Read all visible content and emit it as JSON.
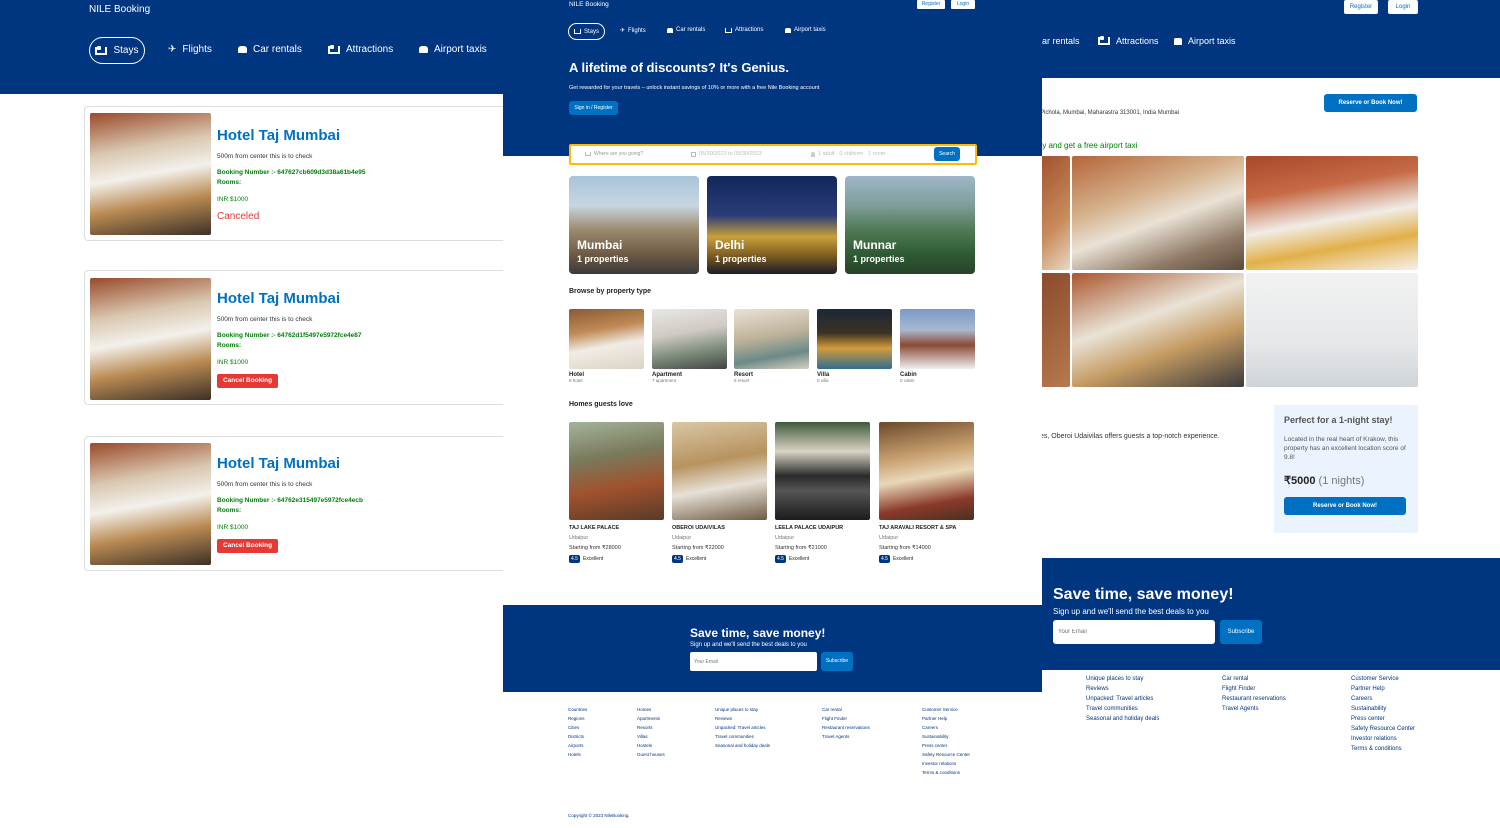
{
  "left": {
    "brand": "NILE Booking",
    "nav": [
      {
        "label": "Stays",
        "icon": "bed-icon"
      },
      {
        "label": "Flights",
        "icon": "plane-icon"
      },
      {
        "label": "Car rentals",
        "icon": "car-icon"
      },
      {
        "label": "Attractions",
        "icon": "bed-icon"
      },
      {
        "label": "Airport taxis",
        "icon": "taxi-icon"
      }
    ],
    "bookings": [
      {
        "title": "Hotel Taj Mumbai",
        "distance": "500m from center this is to check",
        "booking": "Booking Number :- 647627cb609d3d38a61b4e95",
        "rooms": "Rooms:",
        "price": "INR $1000",
        "status": "Canceled",
        "action": ""
      },
      {
        "title": "Hotel Taj Mumbai",
        "distance": "500m from center this is to check",
        "booking": "Booking Number :- 64762d1f5497e5972fce4e87",
        "rooms": "Rooms:",
        "price": "INR $1000",
        "status": "",
        "action": "Cancel Booking"
      },
      {
        "title": "Hotel Taj Mumbai",
        "distance": "500m from center this is to check",
        "booking": "Booking Number :- 64762e315497e5972fce4ecb",
        "rooms": "Rooms:",
        "price": "INR $1000",
        "status": "",
        "action": "Cancel Booking"
      }
    ]
  },
  "middle": {
    "brand": "NILE Booking",
    "register": "Register",
    "login": "Login",
    "nav": [
      "Stays",
      "Flights",
      "Car rentals",
      "Attractions",
      "Airport taxis"
    ],
    "hero_title": "A lifetime of discounts? It's Genius.",
    "hero_text": "Get rewarded for your travels – unlock instant savings of 10% or more with a free Nile Booking account",
    "hero_button": "Sign in / Register",
    "search": {
      "destination_placeholder": "Where are you going?",
      "dates": "05/30/2023 to 05/30/2023",
      "guests": "1 adult · 0 children · 1 room",
      "button": "Search"
    },
    "cities": [
      {
        "name": "Mumbai",
        "count": "1 properties"
      },
      {
        "name": "Delhi",
        "count": "1 properties"
      },
      {
        "name": "Munnar",
        "count": "1 properties"
      }
    ],
    "property_heading": "Browse by property type",
    "property_types": [
      {
        "name": "Hotel",
        "count": "8 hotel"
      },
      {
        "name": "Apartment",
        "count": "7 apartment"
      },
      {
        "name": "Resort",
        "count": "6 resort"
      },
      {
        "name": "Villa",
        "count": "0 villa"
      },
      {
        "name": "Cabin",
        "count": "0 cabin"
      }
    ],
    "homes_heading": "Homes guests love",
    "homes": [
      {
        "name": "TAJ LAKE PALACE",
        "city": "Udaipur",
        "price": "Starting from ₹28000",
        "rating": "4.5",
        "rating_text": "Excellent"
      },
      {
        "name": "OBEROI UDAIVILAS",
        "city": "Udaipur",
        "price": "Starting from ₹22000",
        "rating": "4.5",
        "rating_text": "Excellent"
      },
      {
        "name": "LEELA PALACE UDAIPUR",
        "city": "Udaipur",
        "price": "Starting from ₹21000",
        "rating": "4.5",
        "rating_text": "Excellent"
      },
      {
        "name": "TAJ ARAVALI RESORT & SPA",
        "city": "Udaipur",
        "price": "Starting from ₹14000",
        "rating": "4.5",
        "rating_text": "Excellent"
      }
    ],
    "newsletter": {
      "title": "Save time, save money!",
      "text": "Sign up and we'll send the best deals to you",
      "placeholder": "Your Email",
      "button": "Subscribe"
    },
    "footer": [
      [
        "Countries",
        "Regions",
        "Cities",
        "Districts",
        "Airports",
        "Hotels"
      ],
      [
        "Homes",
        "Apartments",
        "Resorts",
        "Villas",
        "Hostels",
        "Guest houses"
      ],
      [
        "Unique places to stay",
        "Reviews",
        "Unpacked: Travel articles",
        "Travel communities",
        "Seasonal and holiday deals"
      ],
      [
        "Car rental",
        "Flight Finder",
        "Restaurant reservations",
        "Travel Agents"
      ],
      [
        "Customer Service",
        "Partner Help",
        "Careers",
        "Sustainability",
        "Press center",
        "Safety Resource Center",
        "Investor relations",
        "Terms & conditions"
      ]
    ],
    "copyright": "Copyright © 2023 NileBooking."
  },
  "right": {
    "register": "Register",
    "login": "Login",
    "nav": [
      "ar rentals",
      "Attractions",
      "Airport taxis"
    ],
    "reserve_button": "Reserve or Book Now!",
    "address": "Pichola, Mumbai, Maharastra 313001, India Mumbai",
    "promo": "ty and get a free airport taxi",
    "desc": "es, Oberoi Udaivilas offers guests a top-notch experience.",
    "side_title": "Perfect for a 1-night stay!",
    "side_text": "Located in the real heart of Krakow, this property has an excellent location score of 9.8!",
    "price": "₹5000",
    "nights": "(1 nights)",
    "side_button": "Reserve or Book Now!",
    "newsletter": {
      "title": "Save time, save money!",
      "text": "Sign up and we'll send the best deals to you",
      "placeholder": "Your Email",
      "button": "Subscribe"
    },
    "footer": [
      [
        "Unique places to stay",
        "Reviews",
        "Unpacked: Travel articles",
        "Travel communities",
        "Seasonal and holiday deals"
      ],
      [
        "Car rental",
        "Flight Finder",
        "Restaurant reservations",
        "Travel Agents"
      ],
      [
        "Customer Service",
        "Partner Help",
        "Careers",
        "Sustainability",
        "Press center",
        "Safety Resource Center",
        "Investor relations",
        "Terms & conditions"
      ]
    ]
  },
  "colors": {
    "navy": "#003580",
    "blue": "#0071c2",
    "green": "#008009",
    "red": "#e53935",
    "title_blue": "#0071c2"
  }
}
